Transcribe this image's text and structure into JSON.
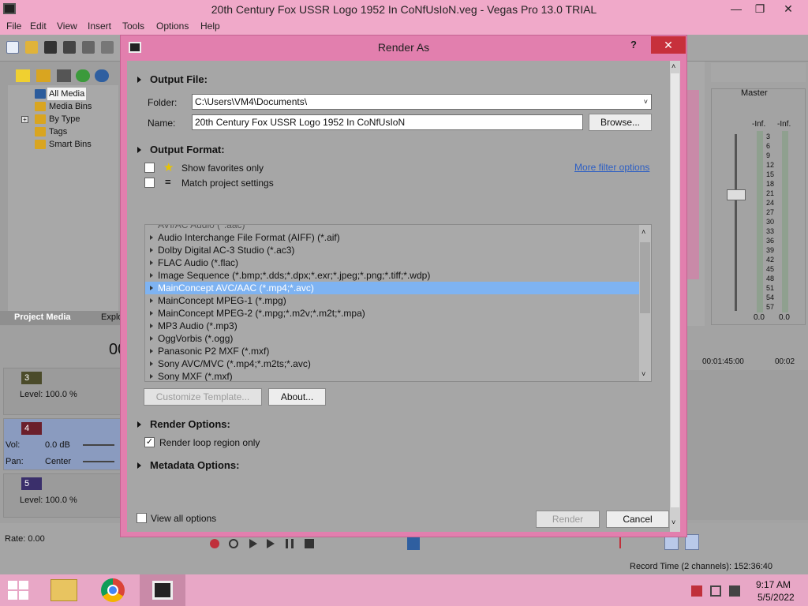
{
  "app": {
    "title": "20th Century Fox USSR Logo 1952 In CoNfUsIoN.veg - Vegas Pro 13.0 TRIAL",
    "menu": [
      "File",
      "Edit",
      "View",
      "Insert",
      "Tools",
      "Options",
      "Help"
    ]
  },
  "explorer": {
    "items": [
      "All Media",
      "Media Bins",
      "By Type",
      "Tags",
      "Smart Bins"
    ],
    "tabs": [
      "Project Media",
      "Explo"
    ]
  },
  "tracks": {
    "t3": {
      "num": "3",
      "level": "Level: 100.0 %"
    },
    "t4": {
      "num": "4",
      "vol_label": "Vol:",
      "vol": "0.0 dB",
      "pan_label": "Pan:",
      "pan": "Center"
    },
    "t5": {
      "num": "5",
      "level": "Level: 100.0 %"
    }
  },
  "timecode_partial": "00",
  "timeline": {
    "t1": "00:01:45:00",
    "t2": "00:02"
  },
  "master": {
    "label": "Master",
    "inf_left": "-Inf.",
    "inf_right": "-Inf.",
    "scale": [
      "3",
      "6",
      "9",
      "12",
      "15",
      "18",
      "21",
      "24",
      "27",
      "30",
      "33",
      "36",
      "39",
      "42",
      "45",
      "48",
      "51",
      "54",
      "57"
    ],
    "val_left": "0.0",
    "val_right": "0.0"
  },
  "status": {
    "rate": "Rate: 0.00",
    "record_time": "Record Time (2 channels): 152:36:40"
  },
  "taskbar": {
    "time": "9:17 AM",
    "date": "5/5/2022"
  },
  "dialog": {
    "title": "Render As",
    "help": "?",
    "close": "✕",
    "output_file": {
      "heading": "Output File:",
      "folder_label": "Folder:",
      "folder_value": "C:\\Users\\VM4\\Documents\\",
      "name_label": "Name:",
      "name_value": "20th Century Fox USSR Logo 1952 In CoNfUsIoN",
      "browse": "Browse..."
    },
    "output_format": {
      "heading": "Output Format:",
      "show_favorites": "Show favorites only",
      "match_project": "Match project settings",
      "more_filter": "More filter options",
      "partial_top": "AVI/AC Audio (*.aac)",
      "formats": [
        "Audio Interchange File Format (AIFF) (*.aif)",
        "Dolby Digital AC-3 Studio (*.ac3)",
        "FLAC Audio (*.flac)",
        "Image Sequence (*.bmp;*.dds;*.dpx;*.exr;*.jpeg;*.png;*.tiff;*.wdp)",
        "MainConcept AVC/AAC (*.mp4;*.avc)",
        "MainConcept MPEG-1 (*.mpg)",
        "MainConcept MPEG-2 (*.mpg;*.m2v;*.m2t;*.mpa)",
        "MP3 Audio (*.mp3)",
        "OggVorbis (*.ogg)",
        "Panasonic P2 MXF (*.mxf)",
        "Sony AVC/MVC (*.mp4;*.m2ts;*.avc)",
        "Sony MXF (*.mxf)"
      ],
      "selected_index": 4,
      "customize": "Customize Template...",
      "about": "About..."
    },
    "render_options": {
      "heading": "Render Options:",
      "loop_region": "Render loop region only",
      "loop_checked": true
    },
    "metadata": {
      "heading": "Metadata Options:"
    },
    "view_all": "View all options",
    "render": "Render",
    "cancel": "Cancel"
  },
  "colors": {
    "accent_pink": "#e27fae",
    "close_red": "#c7303b",
    "selection_blue": "#7eb3f2"
  }
}
